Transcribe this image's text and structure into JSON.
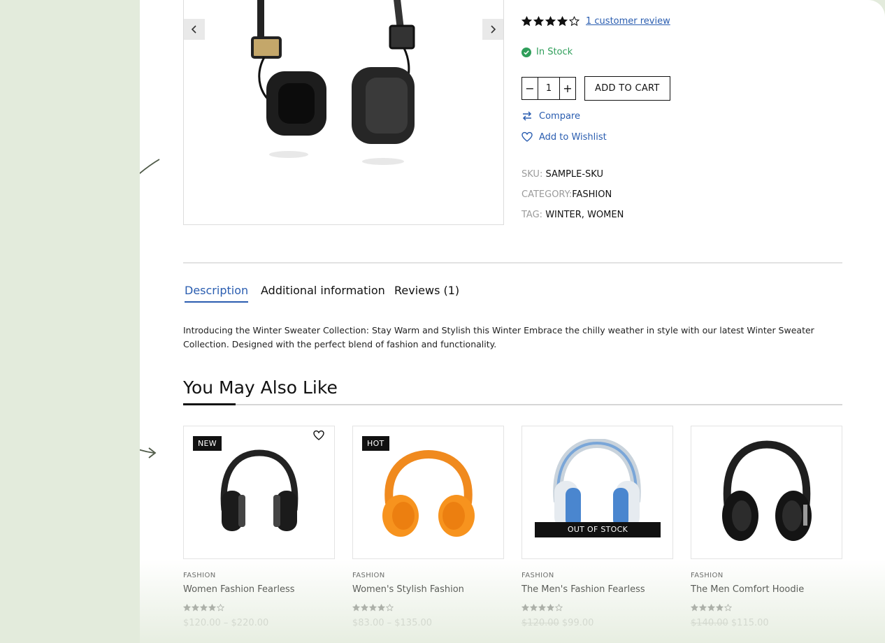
{
  "product": {
    "review_link": "1 customer review",
    "rating": 4,
    "stock": "In Stock",
    "quantity": "1",
    "add_to_cart": "ADD TO CART",
    "compare": "Compare",
    "wishlist": "Add to Wishlist",
    "meta": [
      {
        "key": "SKU:",
        "value": "SAMPLE-SKU"
      },
      {
        "key": "CATEGORY:",
        "value": "FASHION"
      },
      {
        "key": "TAG:",
        "value": "WINTER, WOMEN"
      }
    ]
  },
  "tabs": [
    {
      "label": "Description",
      "active": true
    },
    {
      "label": "Additional information"
    },
    {
      "label": "Reviews (1)"
    }
  ],
  "description": "Introducing the Winter Sweater Collection: Stay Warm and Stylish this Winter Embrace the chilly weather in style with our latest Winter Sweater Collection. Designed with the perfect blend of fashion and functionality.",
  "related": {
    "heading": "You May Also Like",
    "items": [
      {
        "badge": "NEW",
        "category": "FASHION",
        "name": "Women Fashion Fearless",
        "price": "$120.00 – $220.00",
        "rating": 4
      },
      {
        "badge": "HOT",
        "category": "FASHION",
        "name": "Women's Stylish Fashion",
        "price": "$83.00 – $135.00",
        "rating": 4
      },
      {
        "overlay": "OUT OF STOCK",
        "category": "FASHION",
        "name": "The Men's Fashion Fearless",
        "price_old": "$120.00",
        "price": "$99.00",
        "rating": 4
      },
      {
        "category": "FASHION",
        "name": "The Men Comfort Hoodie",
        "price_old": "$140.00",
        "price": "$115.00",
        "rating": 4
      }
    ]
  },
  "colors": {
    "accent": "#2a5db0",
    "stock": "#2f9e5a",
    "background": "#e3ebdc"
  }
}
